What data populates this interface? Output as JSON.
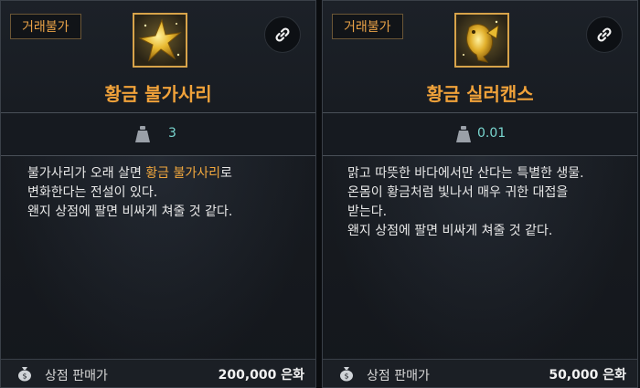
{
  "cards": [
    {
      "badge": "거래불가",
      "title": "황금 불가사리",
      "weight": "3",
      "desc": {
        "line1_pre": "불가사리가 오래 살면 ",
        "line1_hl": "황금 불가사리",
        "line1_post": "로",
        "line2": "변화한다는 전설이 있다.",
        "line3": "왠지 상점에 팔면 비싸게 쳐줄 것 같다."
      },
      "footer_label": "상점 판매가",
      "price": "200,000 은화",
      "icons": {
        "item": "golden-starfish-icon",
        "link": "link-icon",
        "weight": "weight-icon",
        "money": "money-bag-icon"
      }
    },
    {
      "badge": "거래불가",
      "title": "황금 실러캔스",
      "weight": "0.01",
      "desc": {
        "line1": "맑고 따뜻한 바다에서만 산다는 특별한 생물.",
        "line2": "온몸이 황금처럼 빛나서 매우 귀한 대접을",
        "line3": "받는다.",
        "line4": "왠지 상점에 팔면 비싸게 쳐줄 것 같다."
      },
      "footer_label": "상점 판매가",
      "price": "50,000 은화",
      "icons": {
        "item": "golden-coelacanth-icon",
        "link": "link-icon",
        "weight": "weight-icon",
        "money": "money-bag-icon"
      }
    }
  ],
  "colors": {
    "accent": "#f0a23a",
    "weight": "#79d6cf",
    "border": "#4a5058"
  }
}
